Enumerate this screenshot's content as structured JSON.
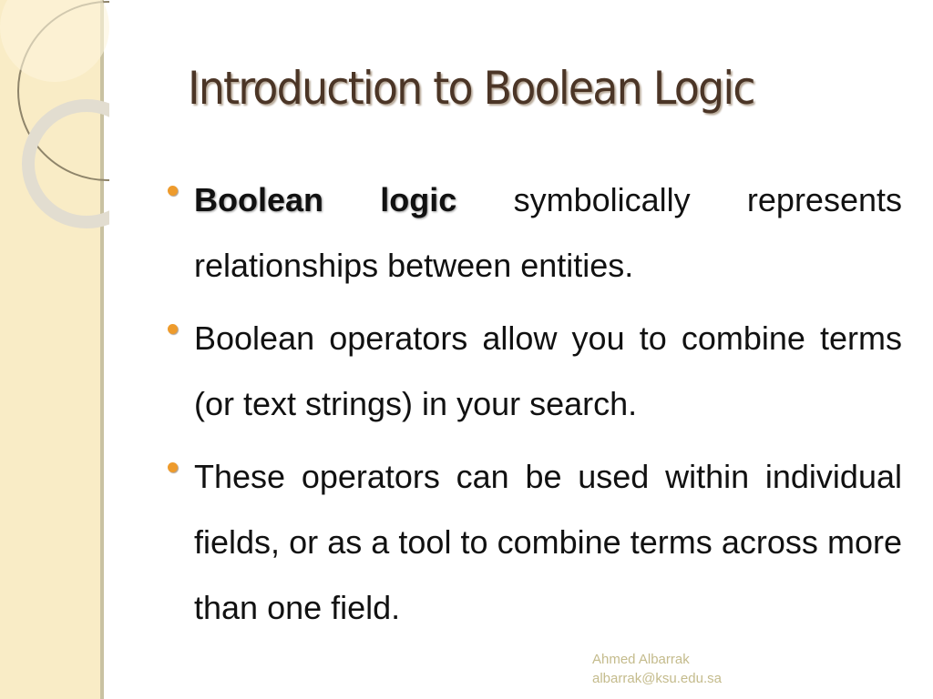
{
  "slide": {
    "title": "Introduction to Boolean Logic",
    "bullets": [
      {
        "bold_lead": "Boolean logic",
        "text": " symbolically represents relationships between entities."
      },
      {
        "bold_lead": "",
        "text": "Boolean operators allow you to combine terms (or text strings) in your search."
      },
      {
        "bold_lead": "",
        "text": "These operators can be used within individual fields, or as a tool to combine terms across more than one field."
      }
    ],
    "footer": {
      "author": "Ahmed Albarrak",
      "email": "albarrak@ksu.edu.sa"
    },
    "colors": {
      "sidebar": "#f9ecc6",
      "title": "#4b3526",
      "bullet": "#ee9b2c",
      "footer": "#c4bb8c"
    }
  }
}
